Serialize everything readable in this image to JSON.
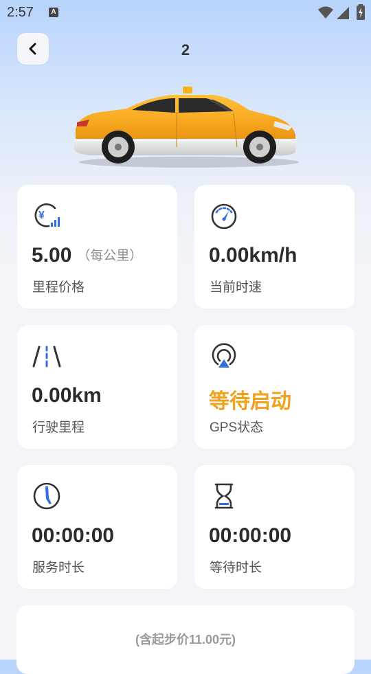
{
  "status_bar": {
    "time": "2:57",
    "notification_glyph": "A"
  },
  "header": {
    "title": "2"
  },
  "cards": {
    "mileage_price": {
      "value": "5.00",
      "unit_note": "（每公里）",
      "label": "里程价格",
      "icon": "yuan-chart-icon"
    },
    "current_speed": {
      "value": "0.00km/h",
      "label": "当前时速",
      "icon": "speedometer-icon"
    },
    "distance": {
      "value": "0.00km",
      "label": "行驶里程",
      "icon": "road-icon"
    },
    "gps_status": {
      "value": "等待启动",
      "label": "GPS状态",
      "icon": "gps-location-icon"
    },
    "service_time": {
      "value": "00:00:00",
      "label": "服务时长",
      "icon": "clock-icon"
    },
    "wait_time": {
      "value": "00:00:00",
      "label": "等待时长",
      "icon": "hourglass-icon"
    }
  },
  "fare": {
    "note": "(含起步价11.00元)"
  },
  "colors": {
    "accent": "#f0a21e",
    "icon_blue": "#2f6fe0",
    "icon_dark": "#333333"
  }
}
